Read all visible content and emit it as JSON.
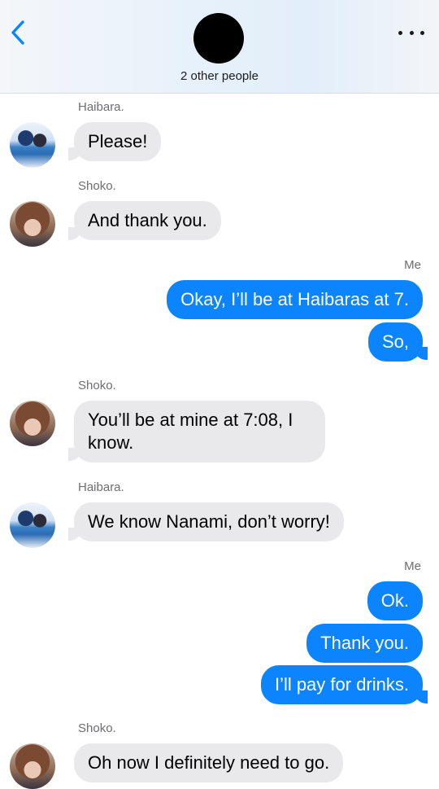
{
  "header": {
    "participants_label": "2 other people",
    "back_icon": "chevron-left-icon",
    "more_icon": "ellipsis-icon",
    "accent_color": "#0b84fe"
  },
  "messages": [
    {
      "sender": "Haibara.",
      "text": "Please!",
      "direction": "incoming"
    },
    {
      "sender": "Shoko.",
      "text": "And thank you.",
      "direction": "incoming"
    },
    {
      "sender": "Me",
      "text": "Okay, I’ll be at Haibaras at 7.",
      "direction": "outgoing"
    },
    {
      "text": "So,",
      "direction": "outgoing"
    },
    {
      "sender": "Shoko.",
      "text_line1": "You’ll be at mine at 7:08, I",
      "text_line2": "know.",
      "direction": "incoming"
    },
    {
      "sender": "Haibara.",
      "text": "We know Nanami, don’t worry!",
      "direction": "incoming"
    },
    {
      "sender": "Me",
      "text": "Ok.",
      "direction": "outgoing"
    },
    {
      "text": "Thank you.",
      "direction": "outgoing"
    },
    {
      "text": "I’ll pay for drinks.",
      "direction": "outgoing"
    },
    {
      "sender": "Shoko.",
      "text": "Oh now I definitely need to go.",
      "direction": "incoming"
    }
  ]
}
